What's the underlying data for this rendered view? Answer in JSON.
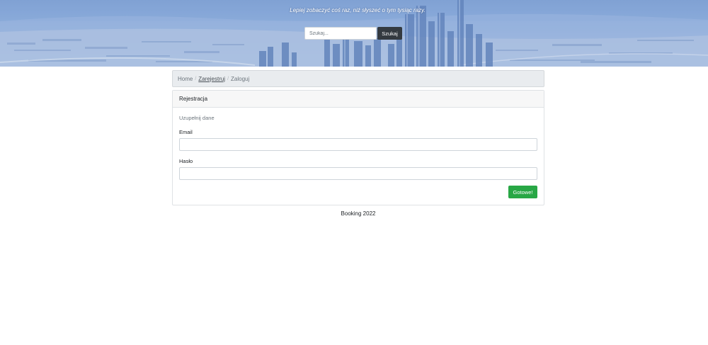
{
  "header": {
    "tagline": "Lepiej zobaczyć coś raz, niż słyszeć o tym tysiąc razy.",
    "search": {
      "placeholder": "Szukaj...",
      "value": "",
      "button_label": "Szukaj"
    }
  },
  "breadcrumb": {
    "separator": "/",
    "items": [
      {
        "label": "Home"
      },
      {
        "label": "Zarejestruj"
      },
      {
        "label": "Zaloguj"
      }
    ]
  },
  "card": {
    "title": "Rejestracja",
    "subtitle": "Uzupełnij dane",
    "email": {
      "label": "Email",
      "value": ""
    },
    "password": {
      "label": "Hasło",
      "value": ""
    },
    "submit_label": "Gotowe!"
  },
  "footer": {
    "text": "Booking 2022"
  },
  "colors": {
    "primary_dark": "#343a40",
    "success": "#28a745",
    "breadcrumb_bg": "#e9ecef",
    "hero_tint": "#8fb0de"
  }
}
